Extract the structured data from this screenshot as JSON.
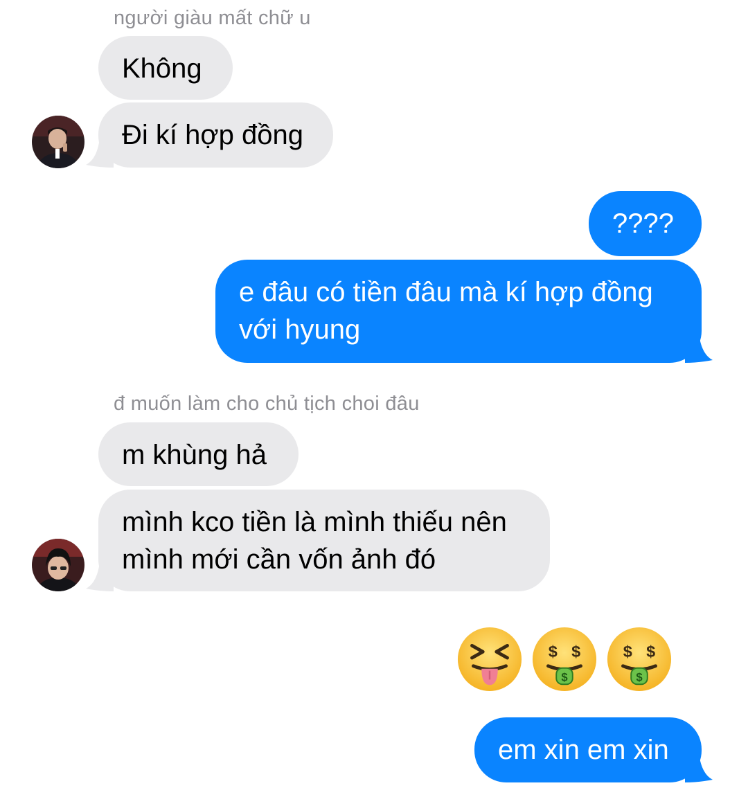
{
  "thread": {
    "group1": {
      "sender": "người giàu mất chữ u",
      "msg1": "Không",
      "msg2": "Đi kí hợp đồng"
    },
    "reply1": {
      "msg1": "????",
      "msg2_line1": "e đâu có tiền đâu mà kí hợp đồng",
      "msg2_line2": "với hyung"
    },
    "group2": {
      "sender": "đ muốn làm cho chủ tịch choi đâu",
      "msg1": "m khùng hả",
      "msg2_line1": "mình kco tiền là mình thiếu nên",
      "msg2_line2": "mình mới cần vốn ảnh đó"
    },
    "reply2": {
      "emojis": [
        "squinting-tongue-face",
        "money-mouth-face",
        "money-mouth-face"
      ],
      "msg1": "em xin em xin"
    }
  },
  "colors": {
    "incoming_bubble": "#e9e9eb",
    "outgoing_bubble": "#0a84ff",
    "sender_name": "#8e8e93"
  }
}
